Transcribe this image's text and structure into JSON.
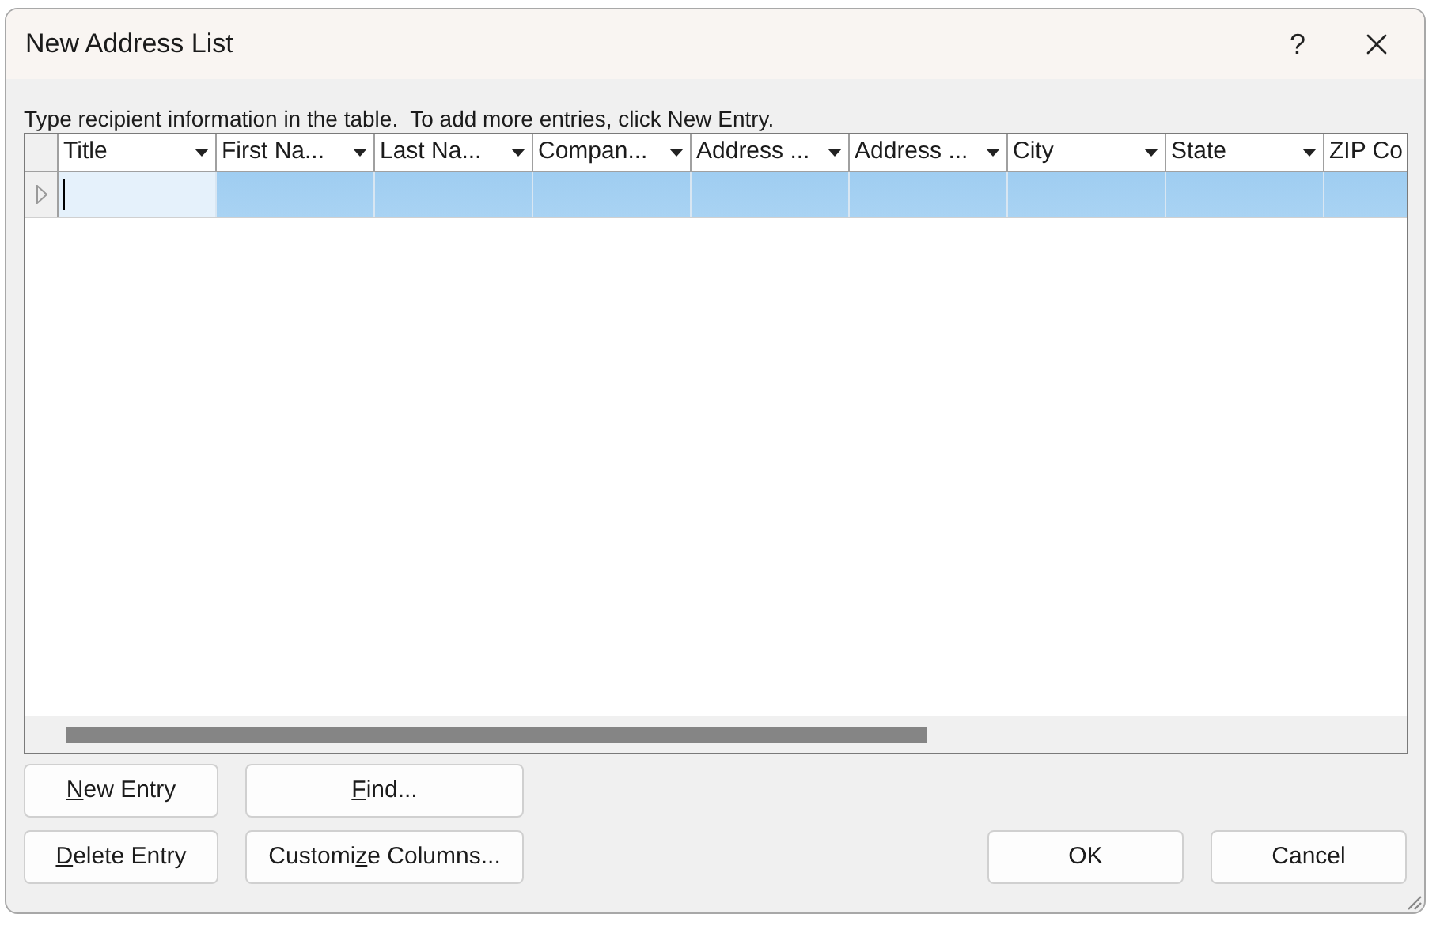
{
  "window": {
    "title": "New Address List",
    "help": "?"
  },
  "instruction": "Type recipient information in the table.  To add more entries, click New Entry.",
  "table": {
    "columns": [
      {
        "label": "Title",
        "dropdown": true
      },
      {
        "label": "First Na...",
        "dropdown": true
      },
      {
        "label": "Last Na...",
        "dropdown": true
      },
      {
        "label": "Compan...",
        "dropdown": true
      },
      {
        "label": "Address ...",
        "dropdown": true
      },
      {
        "label": "Address ...",
        "dropdown": true
      },
      {
        "label": "City",
        "dropdown": true
      },
      {
        "label": "State",
        "dropdown": true
      },
      {
        "label": "ZIP Co",
        "dropdown": false
      }
    ],
    "rows": [
      {
        "selected": true,
        "editing": true
      }
    ]
  },
  "buttons_left": [
    {
      "key": "N",
      "post": "ew Entry"
    },
    {
      "key": "F",
      "post": "ind..."
    },
    {
      "key": "D",
      "post": "elete Entry"
    },
    {
      "pre": "Customi",
      "key": "z",
      "post": "e Columns..."
    }
  ],
  "buttons_right": [
    {
      "pre": "OK"
    },
    {
      "pre": "Cancel"
    }
  ]
}
